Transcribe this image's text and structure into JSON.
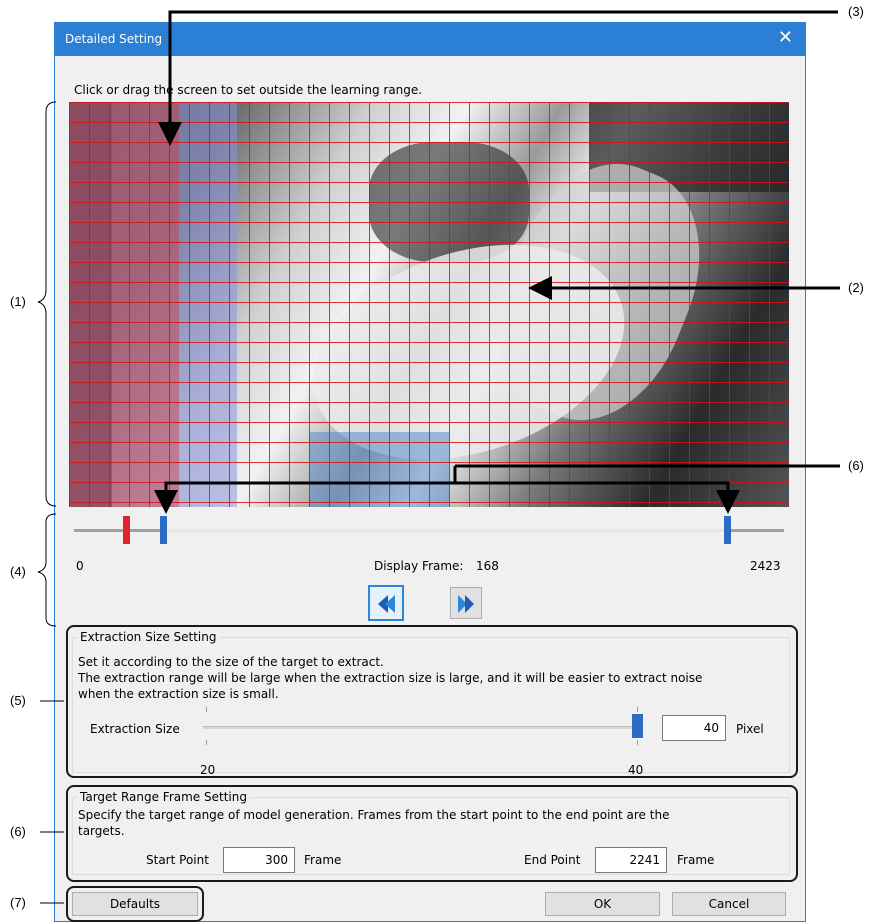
{
  "dialog": {
    "title": "Detailed Setting",
    "close_glyph": "✕",
    "instruction": "Click or drag the screen to set outside the learning range."
  },
  "frame_slider": {
    "min_label": "0",
    "max_label": "2423",
    "display_label": "Display Frame:",
    "display_value": "168",
    "prev_icon": "prev-frame-icon",
    "next_icon": "next-frame-icon"
  },
  "extraction": {
    "group_title": "Extraction Size Setting",
    "desc_line1": "Set it according to the size of the target to extract.",
    "desc_line2": "The extraction range will be large when the extraction size is large, and it will be easier to extract noise",
    "desc_line3": "when the extraction size is small.",
    "label": "Extraction Size",
    "value": "40",
    "unit": "Pixel",
    "min_label": "20",
    "max_label": "40"
  },
  "target_range": {
    "group_title": "Target Range Frame Setting",
    "desc_line1": "Specify the target range of model generation. Frames from the start point to the end point are the",
    "desc_line2": "targets.",
    "start_label": "Start Point",
    "start_value": "300",
    "start_unit": "Frame",
    "end_label": "End Point",
    "end_value": "2241",
    "end_unit": "Frame"
  },
  "buttons": {
    "defaults": "Defaults",
    "ok": "OK",
    "cancel": "Cancel"
  },
  "annotations": {
    "a1": "(1)",
    "a2": "(2)",
    "a3": "(3)",
    "a4": "(4)",
    "a5": "(5)",
    "a6_top": "(6)",
    "a6_bottom": "(6)",
    "a7": "(7)"
  },
  "colors": {
    "title_bar": "#2b7fd4",
    "grid_line": "#d21414",
    "start_marker": "#e0242d",
    "range_marker": "#2d6cc5"
  }
}
